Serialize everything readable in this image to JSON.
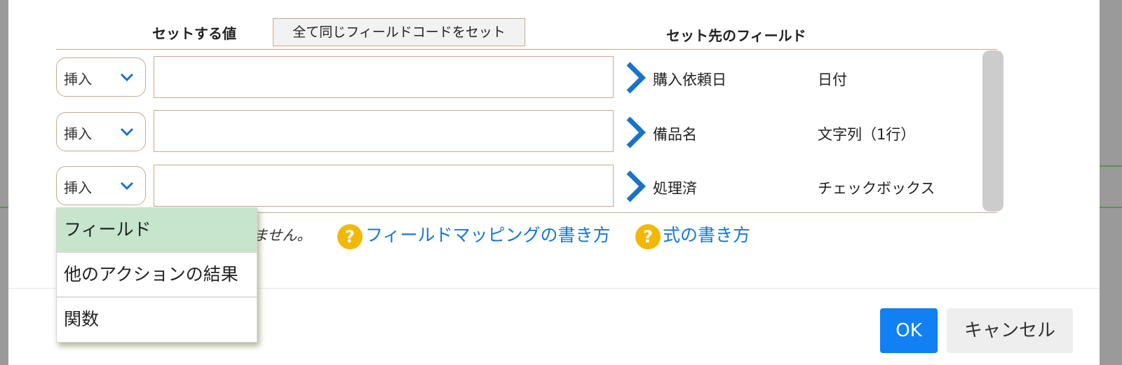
{
  "headers": {
    "value_col": "セットする値",
    "same_code_button": "全て同じフィールドコードをセット",
    "target_col": "セット先のフィールド"
  },
  "rows": [
    {
      "mode": "挿入",
      "value": "",
      "field_name": "購入依頼日",
      "field_type": "日付"
    },
    {
      "mode": "挿入",
      "value": "",
      "field_name": "備品名",
      "field_type": "文字列（1行）"
    },
    {
      "mode": "挿入",
      "value": "",
      "field_name": "処理済",
      "field_type": "チェックボックス"
    }
  ],
  "note_partial": "いません。",
  "help": {
    "mapping_link": "フィールドマッピングの書き方",
    "formula_link": "式の書き方",
    "icon_glyph": "?"
  },
  "dropdown": {
    "options": [
      "フィールド",
      "他のアクションの結果",
      "関数"
    ],
    "highlighted": "フィールド"
  },
  "footer": {
    "ok_label": "OK",
    "cancel_label": "キャンセル"
  },
  "colors": {
    "accent": "#1080f2",
    "link": "#1677d2",
    "help_icon": "#f2b807",
    "highlight": "#c5e5cc",
    "border": "#c8a98c",
    "chevron": "#1a73c8"
  }
}
